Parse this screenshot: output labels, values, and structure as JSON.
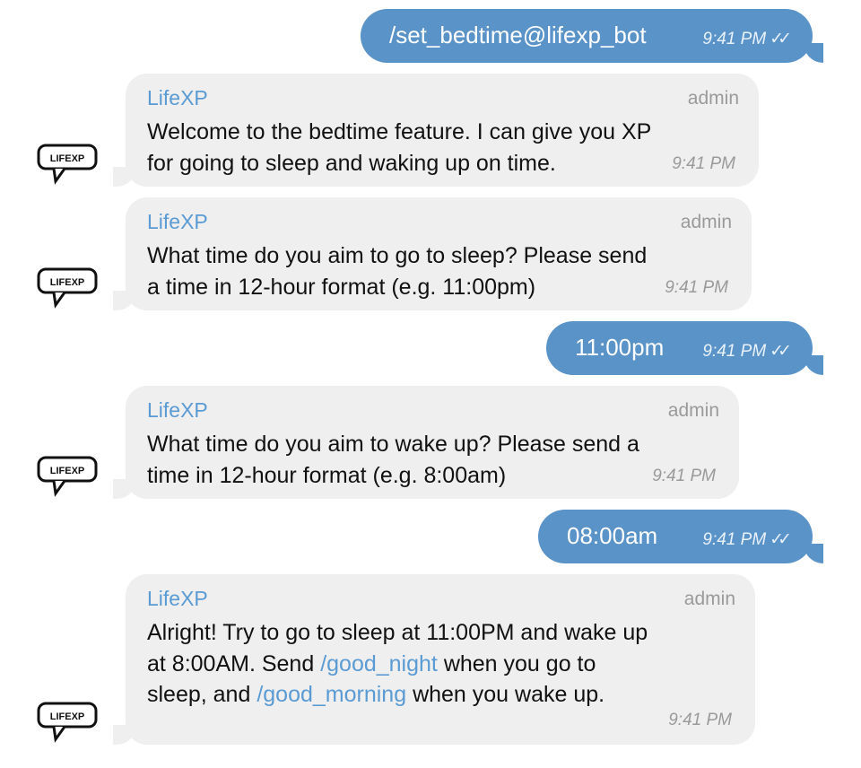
{
  "chat": {
    "outgoing": [
      {
        "text": "/set_bedtime@lifexp_bot",
        "time": "9:41 PM"
      },
      {
        "text": "11:00pm",
        "time": "9:41 PM"
      },
      {
        "text": "08:00am",
        "time": "9:41 PM"
      }
    ],
    "incoming": [
      {
        "sender": "LifeXP",
        "role": "admin",
        "line1": "Welcome to the bedtime feature. I can give you XP",
        "line2": "for going to sleep and waking up on time.",
        "time": "9:41 PM"
      },
      {
        "sender": "LifeXP",
        "role": "admin",
        "line1": "What time do you aim to go to sleep? Please send",
        "line2": "a time in 12-hour format (e.g. 11:00pm)",
        "time": "9:41 PM"
      },
      {
        "sender": "LifeXP",
        "role": "admin",
        "line1": "What time do you aim to wake up? Please send a",
        "line2": "time in 12-hour format (e.g. 8:00am)",
        "time": "9:41 PM"
      },
      {
        "sender": "LifeXP",
        "role": "admin",
        "line1": "Alright! Try to go to sleep at 11:00PM and wake up",
        "line2_pre": "at 8:00AM. Send ",
        "link1": "/good_night",
        "line2_post": " when you go to",
        "line3_pre": "sleep, and ",
        "link2": "/good_morning",
        "line3_post": " when you wake up.",
        "time": "9:41 PM"
      }
    ],
    "avatar_label": "LIFEXP",
    "read_icon": "double-check-icon"
  },
  "colors": {
    "outgoing_bubble": "#5a93c8",
    "incoming_bubble": "#efefef",
    "sender_name": "#5a9bd3",
    "link": "#5a9bd3"
  }
}
